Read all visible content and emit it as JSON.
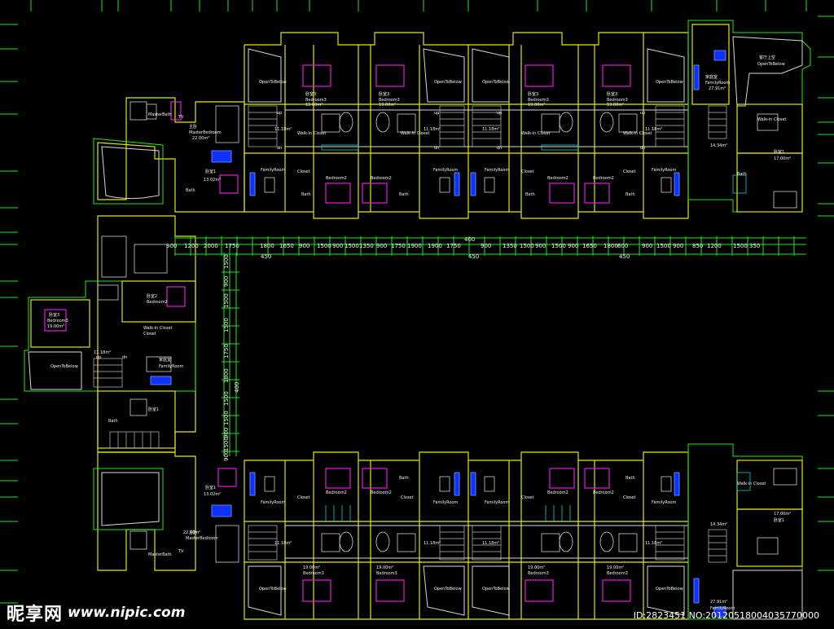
{
  "watermark": {
    "logo_text": "昵享网",
    "url": "www.nipic.com"
  },
  "image_id": "ID:2823451 NO:20120518004035770000",
  "colors": {
    "background": "#000000",
    "wall_yellow": "#e6e600",
    "wall_green": "#1ee61e",
    "furniture_magenta": "#e01ee0",
    "furniture_blue": "#1030ff",
    "text": "#f0f0f0"
  },
  "room_labels": {
    "open_to_below": "OpenToBelow",
    "family_room": "FamilyRoom",
    "family_room_cn": "家庭室",
    "bedroom1": "Bedroom1",
    "bedroom2": "Bedroom2",
    "bedroom3": "Bedroom3",
    "master_bedroom": "MasterBedroom",
    "master_bath": "MasterBath",
    "walk_in_closet": "Walk-in Closet",
    "closet": "Closet",
    "bath": "Bath",
    "up": "up",
    "dn": "dn",
    "tv": "TV",
    "cn_bedroom1": "卧室1",
    "cn_bedroom2": "卧室2",
    "cn_bedroom3": "卧室3",
    "cn_master_bedroom": "主卧",
    "cn_master_bath": "主卫",
    "cn_open_to_below": "客厅上空",
    "area_19": "19.00m²",
    "area_1118": "11.18m²",
    "area_2200": "22.00m²",
    "area_2791": "27.91m²",
    "area_1302": "13.02m²",
    "area_1700": "17.00m²",
    "area_1434": "14.34m²"
  },
  "dimensions": {
    "top_row": [
      "900",
      "1200",
      "2000",
      "1750",
      "1800",
      "1650",
      "900",
      "1500",
      "900",
      "1500",
      "1350",
      "900",
      "1750",
      "1900",
      "1900",
      "1750",
      "900",
      "1350",
      "1500",
      "900",
      "1500",
      "900",
      "1650",
      "1800",
      "600",
      "900",
      "1500",
      "900",
      "850",
      "1200",
      "1500",
      "350"
    ],
    "total_a": "450",
    "total_b": "450",
    "total_c": "400",
    "total_d": "450",
    "left_col": [
      "1500",
      "900",
      "1500",
      "1500",
      "1750",
      "1800",
      "1500",
      "1500",
      "900",
      "1500",
      "900"
    ],
    "left_total": "400"
  }
}
